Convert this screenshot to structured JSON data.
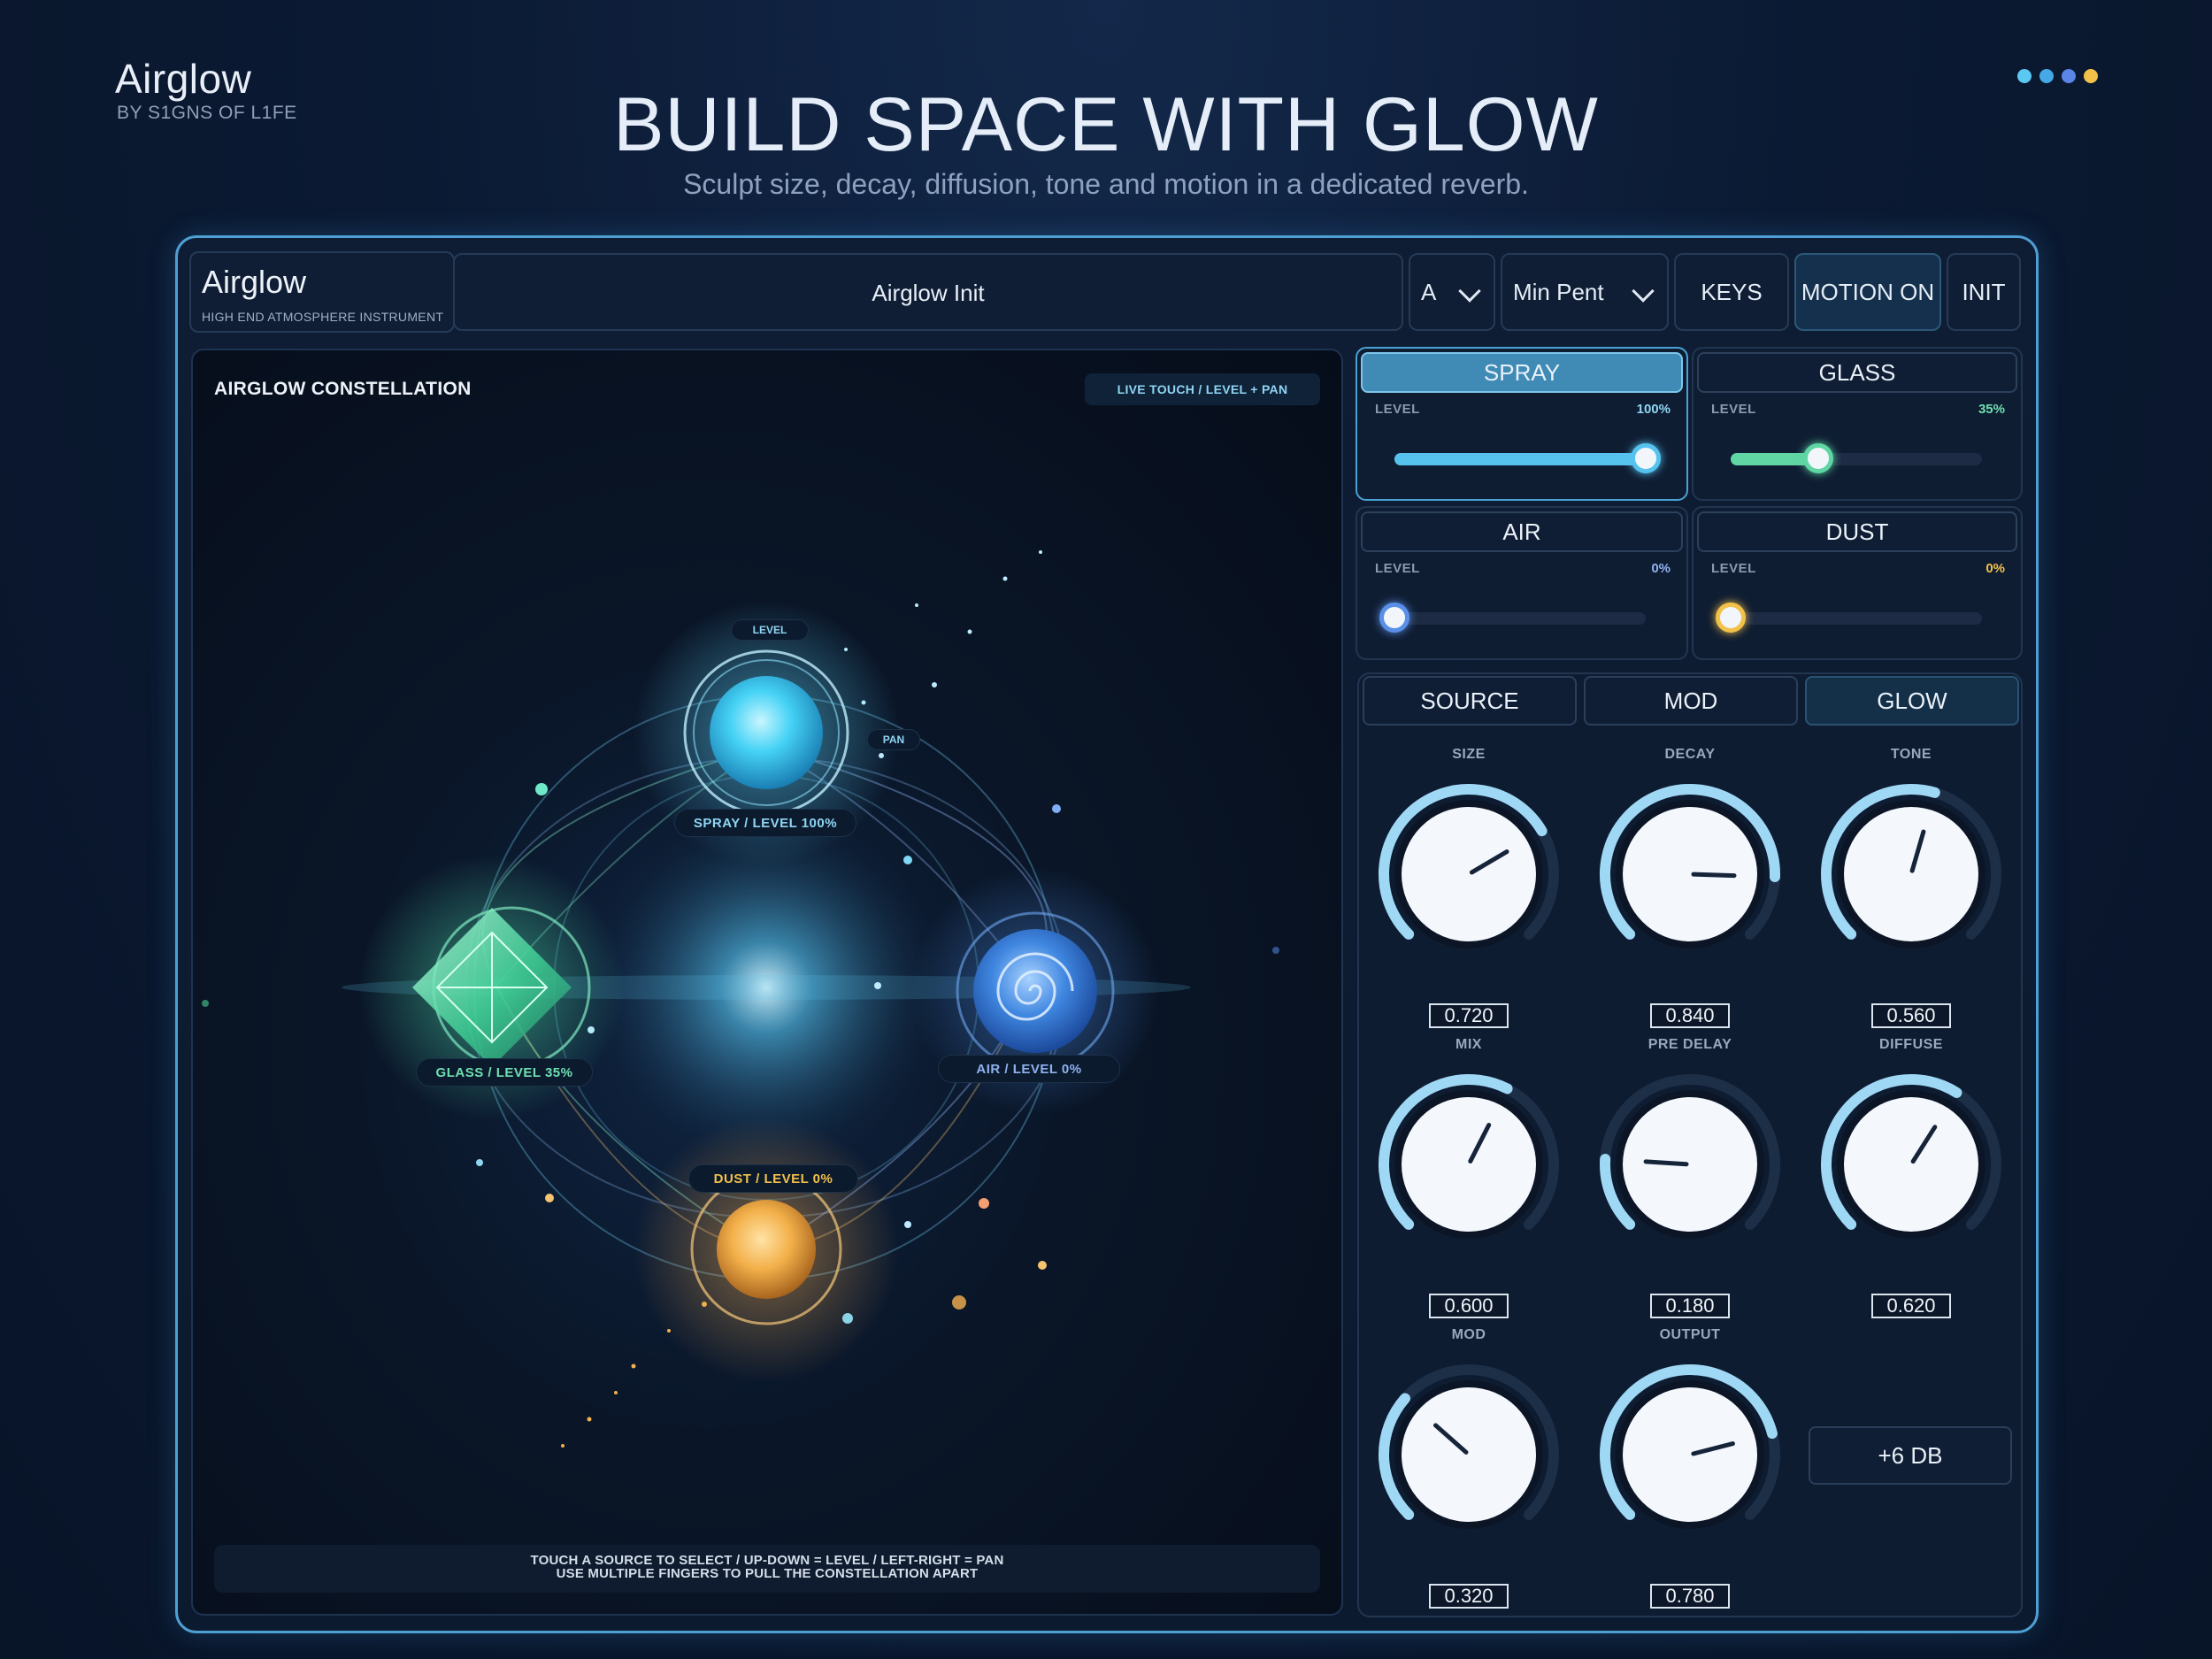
{
  "brand": {
    "name": "Airglow",
    "byline": "BY S1GNS OF L1FE"
  },
  "hero": {
    "title": "BUILD SPACE WITH GLOW",
    "subtitle": "Sculpt size, decay, diffusion, tone and motion in a dedicated reverb."
  },
  "dots": [
    "#5bc8f2",
    "#44a9e6",
    "#5b86e8",
    "#f2c14a"
  ],
  "topbar": {
    "app_name": "Airglow",
    "app_sub": "HIGH END ATMOSPHERE INSTRUMENT",
    "preset": "Airglow Init",
    "key": "A",
    "scale": "Min Pent",
    "keys_button": "KEYS",
    "motion_button": "MOTION ON",
    "init_button": "INIT"
  },
  "constellation": {
    "title": "AIRGLOW CONSTELLATION",
    "live_touch": "LIVE TOUCH  /  LEVEL + PAN",
    "level_tag": "LEVEL",
    "pan_tag": "PAN",
    "nodes": {
      "spray": "SPRAY  /  LEVEL 100%",
      "glass": "GLASS  /  LEVEL 35%",
      "air": "AIR  /  LEVEL 0%",
      "dust": "DUST  /  LEVEL 0%"
    },
    "hint_line1": "TOUCH A SOURCE TO SELECT  /  UP-DOWN = LEVEL  /  LEFT-RIGHT = PAN",
    "hint_line2": "USE MULTIPLE FINGERS TO PULL THE CONSTELLATION APART"
  },
  "sources": [
    {
      "name": "SPRAY",
      "level_label": "LEVEL",
      "level_text": "100%",
      "level": 1.0,
      "color": "#56c3ee",
      "value_color": "#8fd5f3",
      "active": true
    },
    {
      "name": "GLASS",
      "level_label": "LEVEL",
      "level_text": "35%",
      "level": 0.35,
      "color": "#5fd6a3",
      "value_color": "#6fe0b0",
      "active": false
    },
    {
      "name": "AIR",
      "level_label": "LEVEL",
      "level_text": "0%",
      "level": 0.0,
      "color": "#5a8fe8",
      "value_color": "#8fb2ef",
      "active": false
    },
    {
      "name": "DUST",
      "level_label": "LEVEL",
      "level_text": "0%",
      "level": 0.0,
      "color": "#f2c14a",
      "value_color": "#f2c14a",
      "active": false
    }
  ],
  "knob_tabs": [
    "SOURCE",
    "MOD",
    "GLOW"
  ],
  "knob_tab_active": "GLOW",
  "knobs": [
    {
      "label": "SIZE",
      "value": 0.72,
      "display": "0.720"
    },
    {
      "label": "DECAY",
      "value": 0.84,
      "display": "0.840"
    },
    {
      "label": "TONE",
      "value": 0.56,
      "display": "0.560"
    },
    {
      "label": "MIX",
      "value": 0.6,
      "display": "0.600"
    },
    {
      "label": "PRE DELAY",
      "value": 0.18,
      "display": "0.180"
    },
    {
      "label": "DIFFUSE",
      "value": 0.62,
      "display": "0.620"
    },
    {
      "label": "MOD",
      "value": 0.32,
      "display": "0.320"
    },
    {
      "label": "OUTPUT",
      "value": 0.78,
      "display": "0.780"
    }
  ],
  "output_gain": "+6 DB",
  "colors": {
    "accent": "#8fd5f3",
    "frame": "#4e9fd3",
    "knob_arc": "#9fd8f5"
  }
}
